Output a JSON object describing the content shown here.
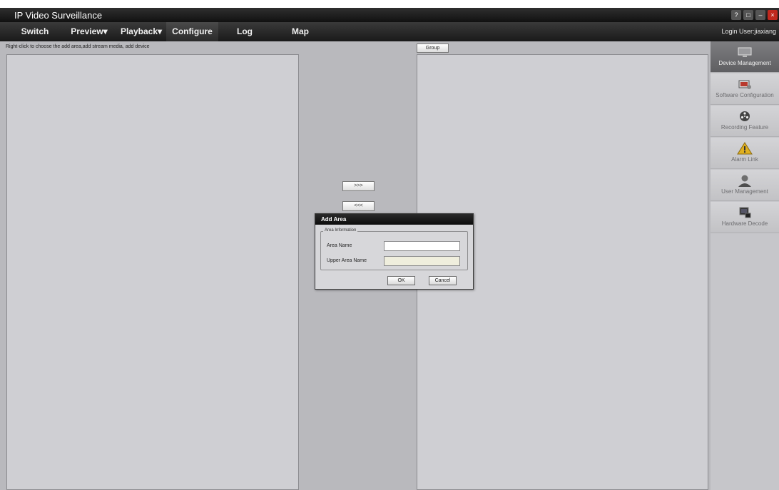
{
  "window": {
    "title": "IP Video Surveillance",
    "controls": [
      "?",
      "□",
      "–",
      "×"
    ]
  },
  "menu": {
    "items": [
      {
        "label": "Switch"
      },
      {
        "label": "Preview▾"
      },
      {
        "label": "Playback▾"
      },
      {
        "label": "Configure"
      },
      {
        "label": "Log"
      },
      {
        "label": "Map"
      }
    ],
    "login": "Login User:jiaxiang"
  },
  "main": {
    "hint": "Right-click to choose the add area,add stream media, add device",
    "group_button": "Group",
    "add_button": ">>>",
    "remove_button": "<<<"
  },
  "sidebar": {
    "items": [
      {
        "label": "Device Management",
        "icon": "monitor-icon"
      },
      {
        "label": "Software Configuration",
        "icon": "software-config-icon"
      },
      {
        "label": "Recording Feature",
        "icon": "film-reel-icon"
      },
      {
        "label": "Alarm Link",
        "icon": "warning-icon"
      },
      {
        "label": "User Management",
        "icon": "user-icon"
      },
      {
        "label": "Hardware Decode",
        "icon": "hardware-decode-icon"
      }
    ]
  },
  "dialog": {
    "title": "Add Area",
    "group_title": "Area Information",
    "area_name_label": "Area Name",
    "area_name_value": "",
    "upper_area_label": "Upper Area Name",
    "upper_area_value": "",
    "ok": "OK",
    "cancel": "Cancel"
  },
  "colors": {
    "accent_close": "#c0281e",
    "menu_bg": "#1a1a1a",
    "panel_bg": "#cfcfd3"
  }
}
